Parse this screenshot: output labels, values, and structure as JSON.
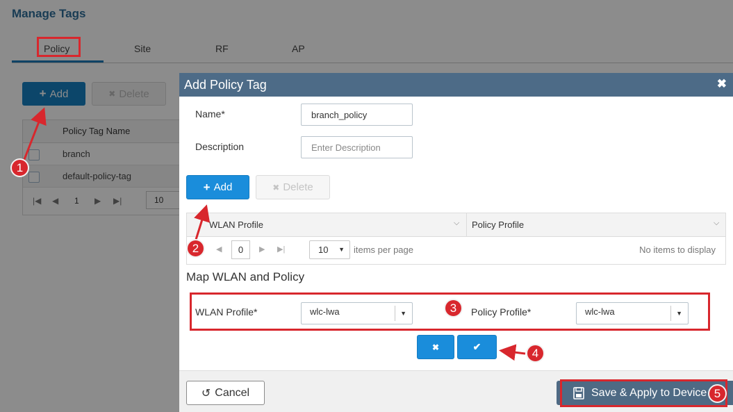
{
  "background": {
    "page_title": "Manage Tags",
    "tabs": [
      {
        "label": "Policy"
      },
      {
        "label": "Site"
      },
      {
        "label": "RF"
      },
      {
        "label": "AP"
      }
    ],
    "add_label": "Add",
    "delete_label": "Delete",
    "grid_header": "Policy Tag Name",
    "rows": [
      "branch",
      "default-policy-tag"
    ],
    "pager_page": "1",
    "pager_size": "10"
  },
  "modal": {
    "title": "Add Policy Tag",
    "close_glyph": "✖",
    "name_label": "Name*",
    "name_value": "branch_policy",
    "description_label": "Description",
    "description_placeholder": "Enter Description",
    "add_label": "Add",
    "delete_label": "Delete",
    "grid": {
      "columns": [
        "WLAN Profile",
        "Policy Profile"
      ],
      "page": "0",
      "page_size": "10",
      "items_per_page": "items per page",
      "empty_text": "No items to display"
    },
    "map_section_title": "Map WLAN and Policy",
    "wlan_profile_label": "WLAN Profile*",
    "wlan_profile_value": "wlc-lwa",
    "policy_profile_label": "Policy Profile*",
    "policy_profile_value": "wlc-lwa",
    "cancel_glyph": "✖",
    "confirm_glyph": "✔",
    "footer_cancel": "Cancel",
    "footer_save": "Save & Apply to Device"
  },
  "annotations": {
    "steps": [
      "1",
      "2",
      "3",
      "4",
      "5"
    ],
    "color": "#d8272d"
  },
  "colors": {
    "primary_button": "#1a8ddb",
    "modal_header": "#4d6b87",
    "title_blue": "#2e6e99"
  }
}
